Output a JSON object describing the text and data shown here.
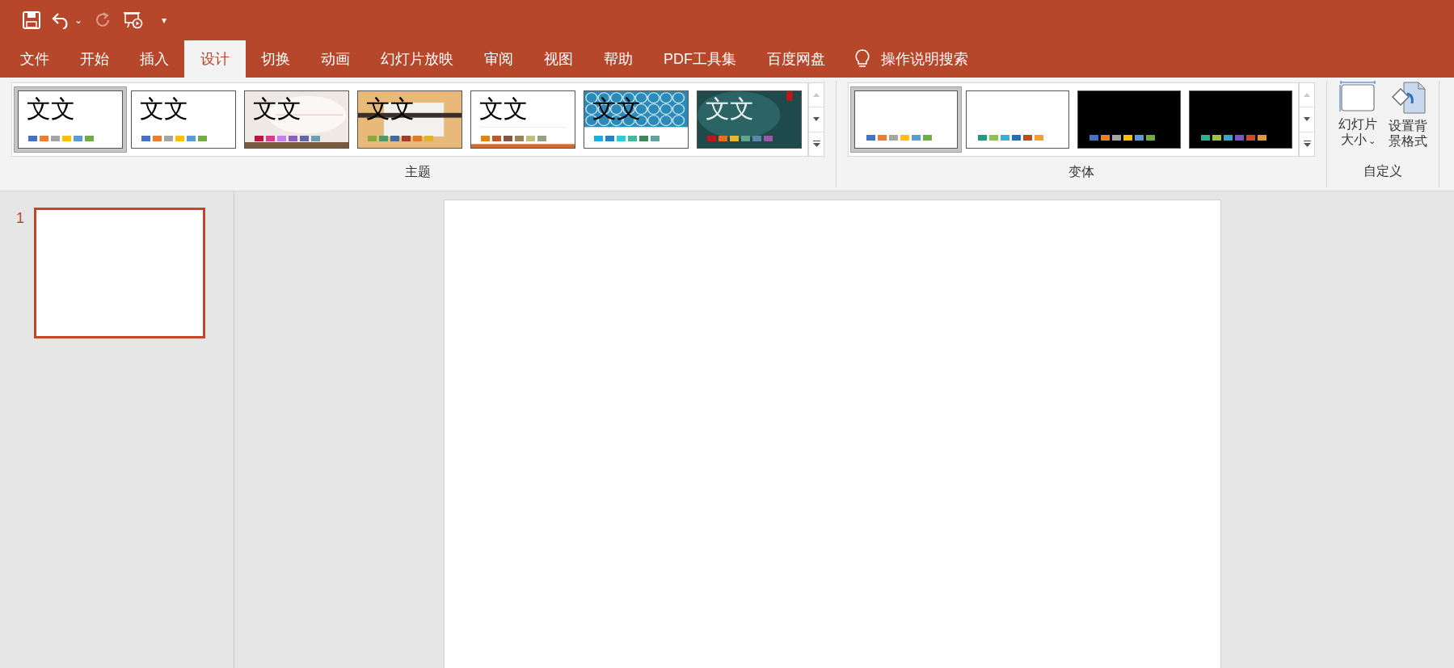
{
  "quick_access": {
    "undo_caret": "⌄",
    "customize_caret": "▾",
    "redo_disabled": true
  },
  "tabs": [
    {
      "label": "文件",
      "selected": false
    },
    {
      "label": "开始",
      "selected": false
    },
    {
      "label": "插入",
      "selected": false
    },
    {
      "label": "设计",
      "selected": true
    },
    {
      "label": "切换",
      "selected": false
    },
    {
      "label": "动画",
      "selected": false
    },
    {
      "label": "幻灯片放映",
      "selected": false
    },
    {
      "label": "审阅",
      "selected": false
    },
    {
      "label": "视图",
      "selected": false
    },
    {
      "label": "帮助",
      "selected": false
    },
    {
      "label": "PDF工具集",
      "selected": false
    },
    {
      "label": "百度网盘",
      "selected": false
    }
  ],
  "tell_me": "操作说明搜索",
  "themes": {
    "label": "主题",
    "items": [
      {
        "kind": "plain",
        "sample": "文文",
        "selected": true,
        "swatches": [
          {
            "color": "#4472c4"
          },
          {
            "color": "#ed7d31"
          },
          {
            "color": "#a5a5a5"
          },
          {
            "color": "#ffc000"
          },
          {
            "color": "#5b9bd5"
          },
          {
            "color": "#70ad47"
          }
        ]
      },
      {
        "kind": "plain",
        "sample": "文文",
        "selected": false,
        "swatches": [
          {
            "color": "#4472c4"
          },
          {
            "color": "#ed7d31"
          },
          {
            "color": "#a5a5a5"
          },
          {
            "color": "#ffc000"
          },
          {
            "color": "#5b9bd5"
          },
          {
            "color": "#70ad47"
          }
        ]
      },
      {
        "kind": "paper",
        "sample": "文文",
        "selected": false,
        "swatches": [
          {
            "color": "#c0143c"
          },
          {
            "color": "#e0398a"
          },
          {
            "color": "#c77ef0"
          },
          {
            "color": "#8b5fbf"
          },
          {
            "color": "#6466a8"
          },
          {
            "color": "#6e9fb0"
          }
        ]
      },
      {
        "kind": "wood",
        "sample": "文文",
        "selected": false,
        "swatches": [
          {
            "color": "#8ea53a"
          },
          {
            "color": "#4a9a6c"
          },
          {
            "color": "#44699b"
          },
          {
            "color": "#a33a2e"
          },
          {
            "color": "#e07a2c"
          },
          {
            "color": "#e3b22c"
          }
        ]
      },
      {
        "kind": "lines",
        "sample": "文文",
        "selected": false,
        "swatches": [
          {
            "color": "#e48312"
          },
          {
            "color": "#bd582c"
          },
          {
            "color": "#865640"
          },
          {
            "color": "#9b8357"
          },
          {
            "color": "#c2bc80"
          },
          {
            "color": "#94a088"
          }
        ]
      },
      {
        "kind": "pattern",
        "sample": "文文",
        "selected": false,
        "swatches": [
          {
            "color": "#1cade4"
          },
          {
            "color": "#2683c6"
          },
          {
            "color": "#27ced7"
          },
          {
            "color": "#42ba97"
          },
          {
            "color": "#3e8853"
          },
          {
            "color": "#62a39f"
          }
        ]
      },
      {
        "kind": "dark",
        "sample": "文文",
        "selected": false,
        "swatches": [
          {
            "color": "#c0171c"
          },
          {
            "color": "#e96e1a"
          },
          {
            "color": "#e8b828"
          },
          {
            "color": "#5da78b"
          },
          {
            "color": "#5b87a8"
          },
          {
            "color": "#9a5ba6"
          }
        ]
      }
    ]
  },
  "variants": {
    "label": "变体",
    "items": [
      {
        "kind": "light",
        "selected": true,
        "swatches": [
          {
            "color": "#4472c4"
          },
          {
            "color": "#ed7d31"
          },
          {
            "color": "#a5a5a5"
          },
          {
            "color": "#ffc000"
          },
          {
            "color": "#5b9bd5"
          },
          {
            "color": "#70ad47"
          }
        ]
      },
      {
        "kind": "light",
        "selected": false,
        "swatches": [
          {
            "color": "#1f9c7f"
          },
          {
            "color": "#8fc24c"
          },
          {
            "color": "#36b1d2"
          },
          {
            "color": "#2470b0"
          },
          {
            "color": "#bb4a1c"
          },
          {
            "color": "#f1a224"
          }
        ]
      },
      {
        "kind": "dark",
        "selected": false,
        "swatches": [
          {
            "color": "#4472c4"
          },
          {
            "color": "#ed7d31"
          },
          {
            "color": "#a5a5a5"
          },
          {
            "color": "#ffc000"
          },
          {
            "color": "#5b9bd5"
          },
          {
            "color": "#70ad47"
          }
        ]
      },
      {
        "kind": "dark",
        "selected": false,
        "swatches": [
          {
            "color": "#2db290"
          },
          {
            "color": "#9bc54a"
          },
          {
            "color": "#3aa3d4"
          },
          {
            "color": "#7b57c4"
          },
          {
            "color": "#cf4a2c"
          },
          {
            "color": "#de9a35"
          }
        ]
      }
    ]
  },
  "customize": {
    "label": "自定义",
    "buttons": [
      {
        "kind": "size",
        "label": "幻灯片大小",
        "caret": "⌄"
      },
      {
        "kind": "background",
        "label": "设置背景格式"
      }
    ]
  },
  "slides": [
    {
      "number": "1",
      "selected": true
    }
  ]
}
